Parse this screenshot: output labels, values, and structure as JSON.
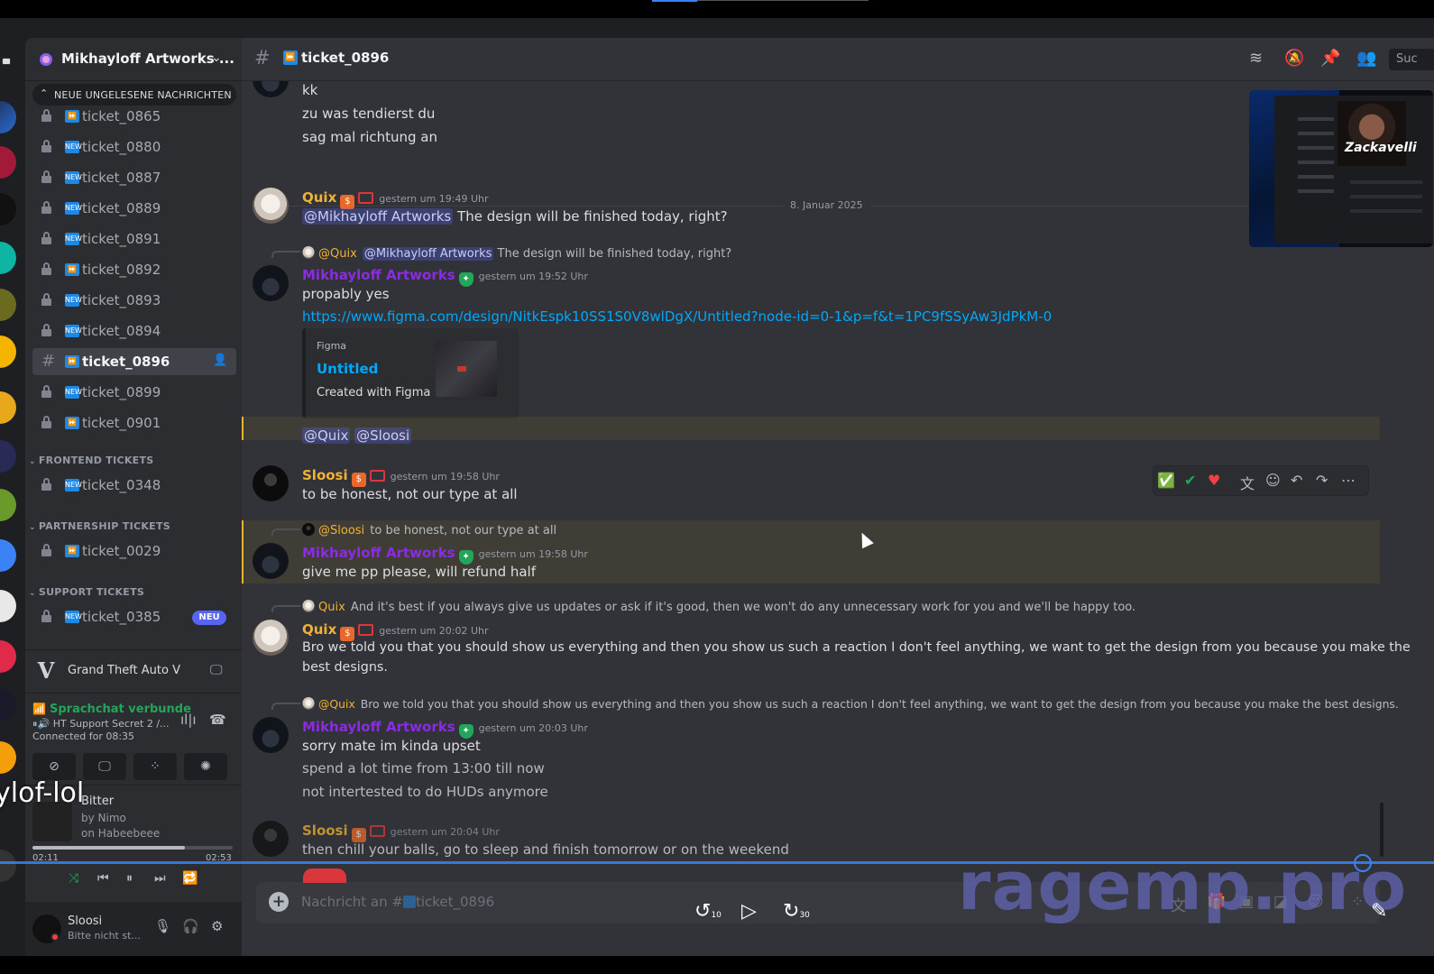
{
  "colors": {
    "accent": "#5865f2",
    "online_green": "#23a55a",
    "mention_bg": "#3c3f8a",
    "quix_color": "#f0b232",
    "mikhayloff_color": "#8b2be2"
  },
  "guild": {
    "name": "Mikhayloff Artworks ..."
  },
  "unread_pill": "NEUE UNGELESENE NACHRICHTEN",
  "channels": [
    {
      "name": "ticket_0865",
      "emoji": "forward"
    },
    {
      "name": "ticket_0880",
      "emoji": "new"
    },
    {
      "name": "ticket_0887",
      "emoji": "new"
    },
    {
      "name": "ticket_0889",
      "emoji": "new"
    },
    {
      "name": "ticket_0891",
      "emoji": "new"
    },
    {
      "name": "ticket_0892",
      "emoji": "forward"
    },
    {
      "name": "ticket_0893",
      "emoji": "new"
    },
    {
      "name": "ticket_0894",
      "emoji": "new"
    },
    {
      "name": "ticket_0896",
      "emoji": "forward",
      "active": true
    },
    {
      "name": "ticket_0899",
      "emoji": "new"
    },
    {
      "name": "ticket_0901",
      "emoji": "forward"
    }
  ],
  "categories": [
    {
      "name": "FRONTEND TICKETS",
      "channels": [
        {
          "name": "ticket_0348"
        }
      ]
    },
    {
      "name": "PARTNERSHIP TICKETS",
      "channels": [
        {
          "name": "ticket_0029"
        }
      ]
    },
    {
      "name": "SUPPORT TICKETS",
      "channels": [
        {
          "name": "ticket_0385",
          "badge": "NEU"
        }
      ]
    }
  ],
  "game": {
    "name": "Grand Theft Auto V"
  },
  "voice": {
    "status": "Sprachchat verbunde",
    "channel": "HT Support Secret 2 /...",
    "time": "Connected for 08:35"
  },
  "music": {
    "title": "Bitter",
    "by": "by Nimo",
    "on": "on Habeebeee",
    "elapsed": "02:11",
    "total": "02:53",
    "progress": 0.76
  },
  "user": {
    "name": "Sloosi",
    "status": "Bitte nicht st..."
  },
  "header": {
    "channel": "ticket_0896",
    "search": "Suc"
  },
  "messages": {
    "top_lines": [
      "kk",
      "zu was tendierst du",
      "sag mal richtung an"
    ],
    "date_divider": "8. Januar 2025",
    "m1": {
      "author": "Quix",
      "time": "gestern um 19:49 Uhr",
      "mention": "@Mikhayloff Artworks",
      "text": "The design will be finished today, right?"
    },
    "m2": {
      "reply_author": "@Quix",
      "reply_mention": "@Mikhayloff Artworks",
      "reply_text": "The design will be finished today, right?",
      "author": "Mikhayloff Artworks",
      "time": "gestern um 19:52 Uhr",
      "text": "propably yes",
      "link": "https://www.figma.com/design/NitkEspk10SS1S0V8wlDgX/Untitled?node-id=0-1&p=f&t=1PC9fSSyAw3JdPkM-0",
      "embed": {
        "provider": "Figma",
        "title": "Untitled",
        "description": "Created with Figma"
      },
      "mentions": [
        "@Quix",
        "@Sloosi"
      ]
    },
    "m3": {
      "author": "Sloosi",
      "time": "gestern um 19:58 Uhr",
      "text": "to be honest, not our type at all"
    },
    "m4": {
      "reply_author": "@Sloosi",
      "reply_text": "to be honest, not our type at all",
      "author": "Mikhayloff Artworks",
      "time": "gestern um 19:58 Uhr",
      "text": "give me pp please, will refund half"
    },
    "m5": {
      "reply_author": "Quix",
      "reply_text": "And it's best if you always give us updates or ask if it's good, then we won't do any unnecessary work for you and we'll be happy too.",
      "author": "Quix",
      "time": "gestern um 20:02 Uhr",
      "text1": "Bro we told you that you should show us everything and then you show us such a reaction I don't feel anything, we want to get the design from you because you make the",
      "text2": "best designs."
    },
    "m6": {
      "reply_author": "@Quix",
      "reply_text": "Bro we told you that you should show us everything and then you show us such a reaction I don't feel anything, we want to get the design from you because you make the best designs.",
      "author": "Mikhayloff Artworks",
      "time": "gestern um 20:03 Uhr",
      "lines": [
        "sorry mate im kinda upset",
        "spend a lot time from 13:00 till now",
        "not intertested to do HUDs anymore"
      ]
    },
    "m7": {
      "author": "Sloosi",
      "time": "gestern um 20:04 Uhr",
      "text": "then chill your balls, go to sleep and finish tomorrow or on the weekend"
    }
  },
  "composer": {
    "placeholder": "Nachricht an #",
    "placeholder_channel": "ticket_0896"
  },
  "pip": {
    "name": "Zackavelli"
  },
  "player": {
    "rewind": "10",
    "forward": "30",
    "progress": 0.95
  },
  "watermark": "ragemp.pro",
  "overlay_text": "ylof-lol"
}
